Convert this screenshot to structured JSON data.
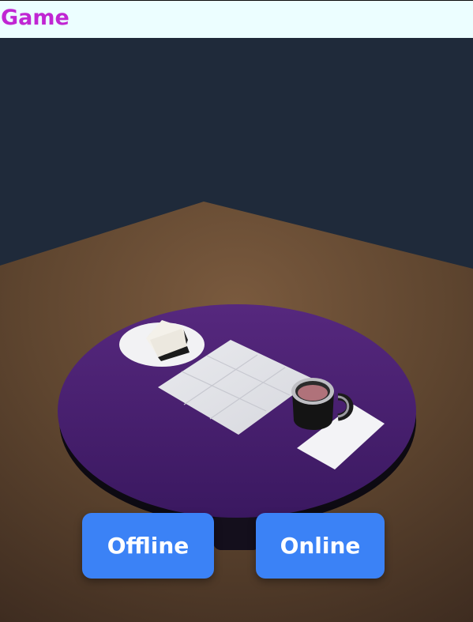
{
  "header": {
    "title": "Game"
  },
  "menu": {
    "offline_label": "Offline",
    "online_label": "Online"
  },
  "colors": {
    "header_bg": "#ecfeff",
    "title": "#c026d3",
    "button": "#3b82f6",
    "table": "#4a2580",
    "wall": "#1f2a3a",
    "floor": "#6b4e36"
  }
}
